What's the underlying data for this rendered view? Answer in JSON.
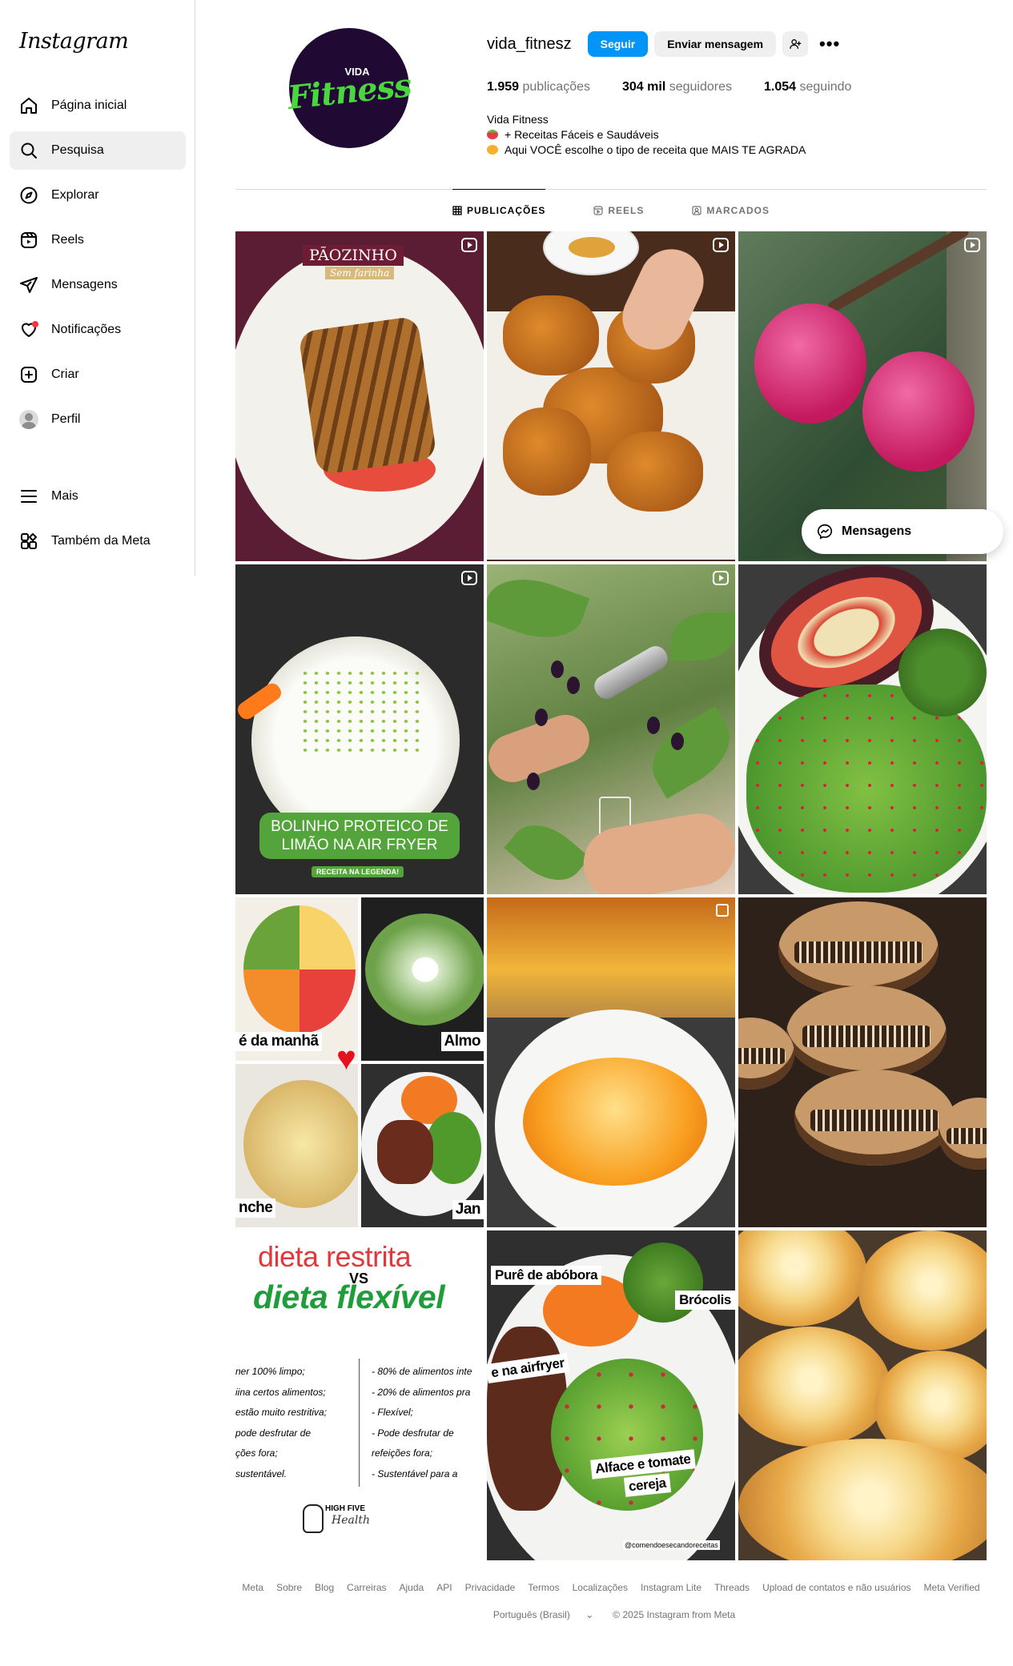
{
  "app": {
    "logo": "Instagram"
  },
  "sidebar": {
    "items": [
      {
        "label": "Página inicial",
        "icon": "home-icon"
      },
      {
        "label": "Pesquisa",
        "icon": "search-icon",
        "active": true
      },
      {
        "label": "Explorar",
        "icon": "compass-icon"
      },
      {
        "label": "Reels",
        "icon": "reels-icon"
      },
      {
        "label": "Mensagens",
        "icon": "messages-icon"
      },
      {
        "label": "Notificações",
        "icon": "heart-icon",
        "has_dot": true
      },
      {
        "label": "Criar",
        "icon": "plus-square-icon"
      },
      {
        "label": "Perfil",
        "icon": "avatar-icon"
      }
    ],
    "bottom_items": [
      {
        "label": "Mais",
        "icon": "menu-icon"
      },
      {
        "label": "Também da Meta",
        "icon": "meta-apps-icon"
      }
    ]
  },
  "profile": {
    "pic_top": "VIDA",
    "pic_main": "Fitness",
    "username": "vida_fitnesz",
    "follow_label": "Seguir",
    "message_label": "Enviar mensagem",
    "stats": {
      "posts_value": "1.959",
      "posts_label": "publicações",
      "followers_value": "304 mil",
      "followers_label": "seguidores",
      "following_value": "1.054",
      "following_label": "seguindo"
    },
    "bio": {
      "name": "Vida Fitness",
      "line1": "+ Receitas Fáceis e Saudáveis",
      "line2": "Aqui VOCÊ escolhe o tipo de receita que MAIS TE AGRADA"
    }
  },
  "tabs": [
    "PUBLICAÇÕES",
    "REELS",
    "MARCADOS"
  ],
  "posts": {
    "p1": {
      "title": "PÃOZINHO",
      "subtitle": "Sem farinha"
    },
    "p4": {
      "banner": "BOLINHO PROTEICO DE LIMÃO NA AIR FRYER",
      "sub": "RECEITA NA LEGENDA!"
    },
    "p7": {
      "l1": "é da manhã",
      "l2": "Almo",
      "l3": "nche",
      "l4": "Jan"
    },
    "p10": {
      "t1": "dieta restrita",
      "vs": "VS",
      "t2": "dieta flexível",
      "left": [
        "ner 100% limpo;",
        "iina certos alimentos;",
        "estão muito restritiva;",
        "pode desfrutar de",
        "ções fora;",
        "sustentável."
      ],
      "right": [
        "- 80% de alimentos inte",
        "- 20% de alimentos pra",
        "- Flexível;",
        "- Pode desfrutar de",
        "refeições fora;",
        "- Sustentável para a"
      ],
      "brand1": "HIGH FIVE",
      "brand2": "Health"
    },
    "p11": {
      "l1": "Purê de abóbora",
      "l2": "Brócolis",
      "l3": "e na airfryer",
      "l4": "Alface e tomate",
      "l5": "cereja",
      "credit": "@comendoesecandoreceitas"
    }
  },
  "floating": {
    "messages_label": "Mensagens"
  },
  "footer": {
    "links": [
      "Meta",
      "Sobre",
      "Blog",
      "Carreiras",
      "Ajuda",
      "API",
      "Privacidade",
      "Termos",
      "Localizações",
      "Instagram Lite",
      "Threads",
      "Upload de contatos e não usuários",
      "Meta Verified"
    ],
    "language": "Português (Brasil)",
    "copyright": "© 2025 Instagram from Meta"
  }
}
